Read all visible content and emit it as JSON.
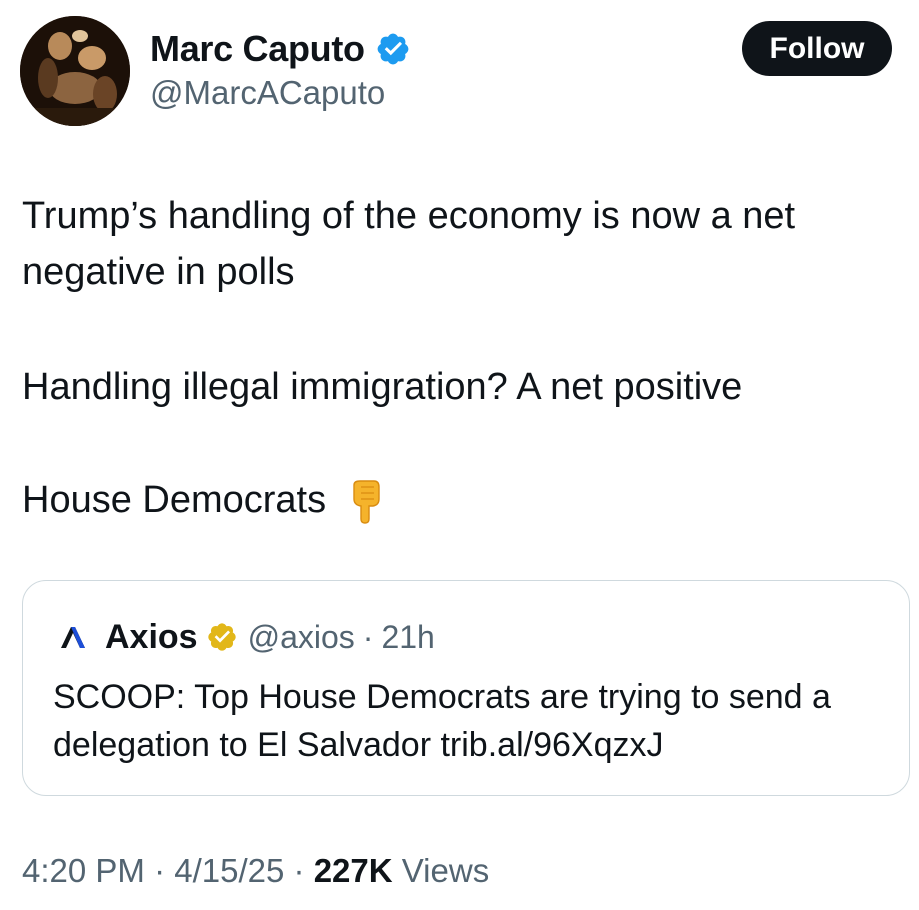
{
  "author": {
    "display_name": "Marc Caputo",
    "handle": "@MarcACaputo",
    "verified_badge": "blue-verified-icon",
    "avatar": "profile-avatar"
  },
  "follow_button": {
    "label": "Follow"
  },
  "tweet": {
    "line1": "Trump’s handling of the economy is now a net",
    "line2": "negative in polls",
    "line3": "Handling illegal immigration? A net positive",
    "line4": "House Democrats",
    "emoji": "backhand-index-pointing-down"
  },
  "quote": {
    "logo": "axios-logo-icon",
    "name": "Axios",
    "verified_badge": "gold-verified-icon",
    "handle": "@axios",
    "separator": "·",
    "time": "21h",
    "body": "SCOOP: Top House Democrats are trying to send a delegation to El Salvador trib.al/96XqzxJ"
  },
  "meta": {
    "time": "4:20 PM",
    "sep1": "·",
    "date": "4/15/25",
    "sep2": "·",
    "views_count": "227K",
    "views_label": "Views"
  },
  "colors": {
    "text": "#0f1419",
    "secondary": "#536471",
    "verified_blue": "#1d9bf0",
    "verified_gold": "#e2b719",
    "border": "#cfd9de"
  }
}
